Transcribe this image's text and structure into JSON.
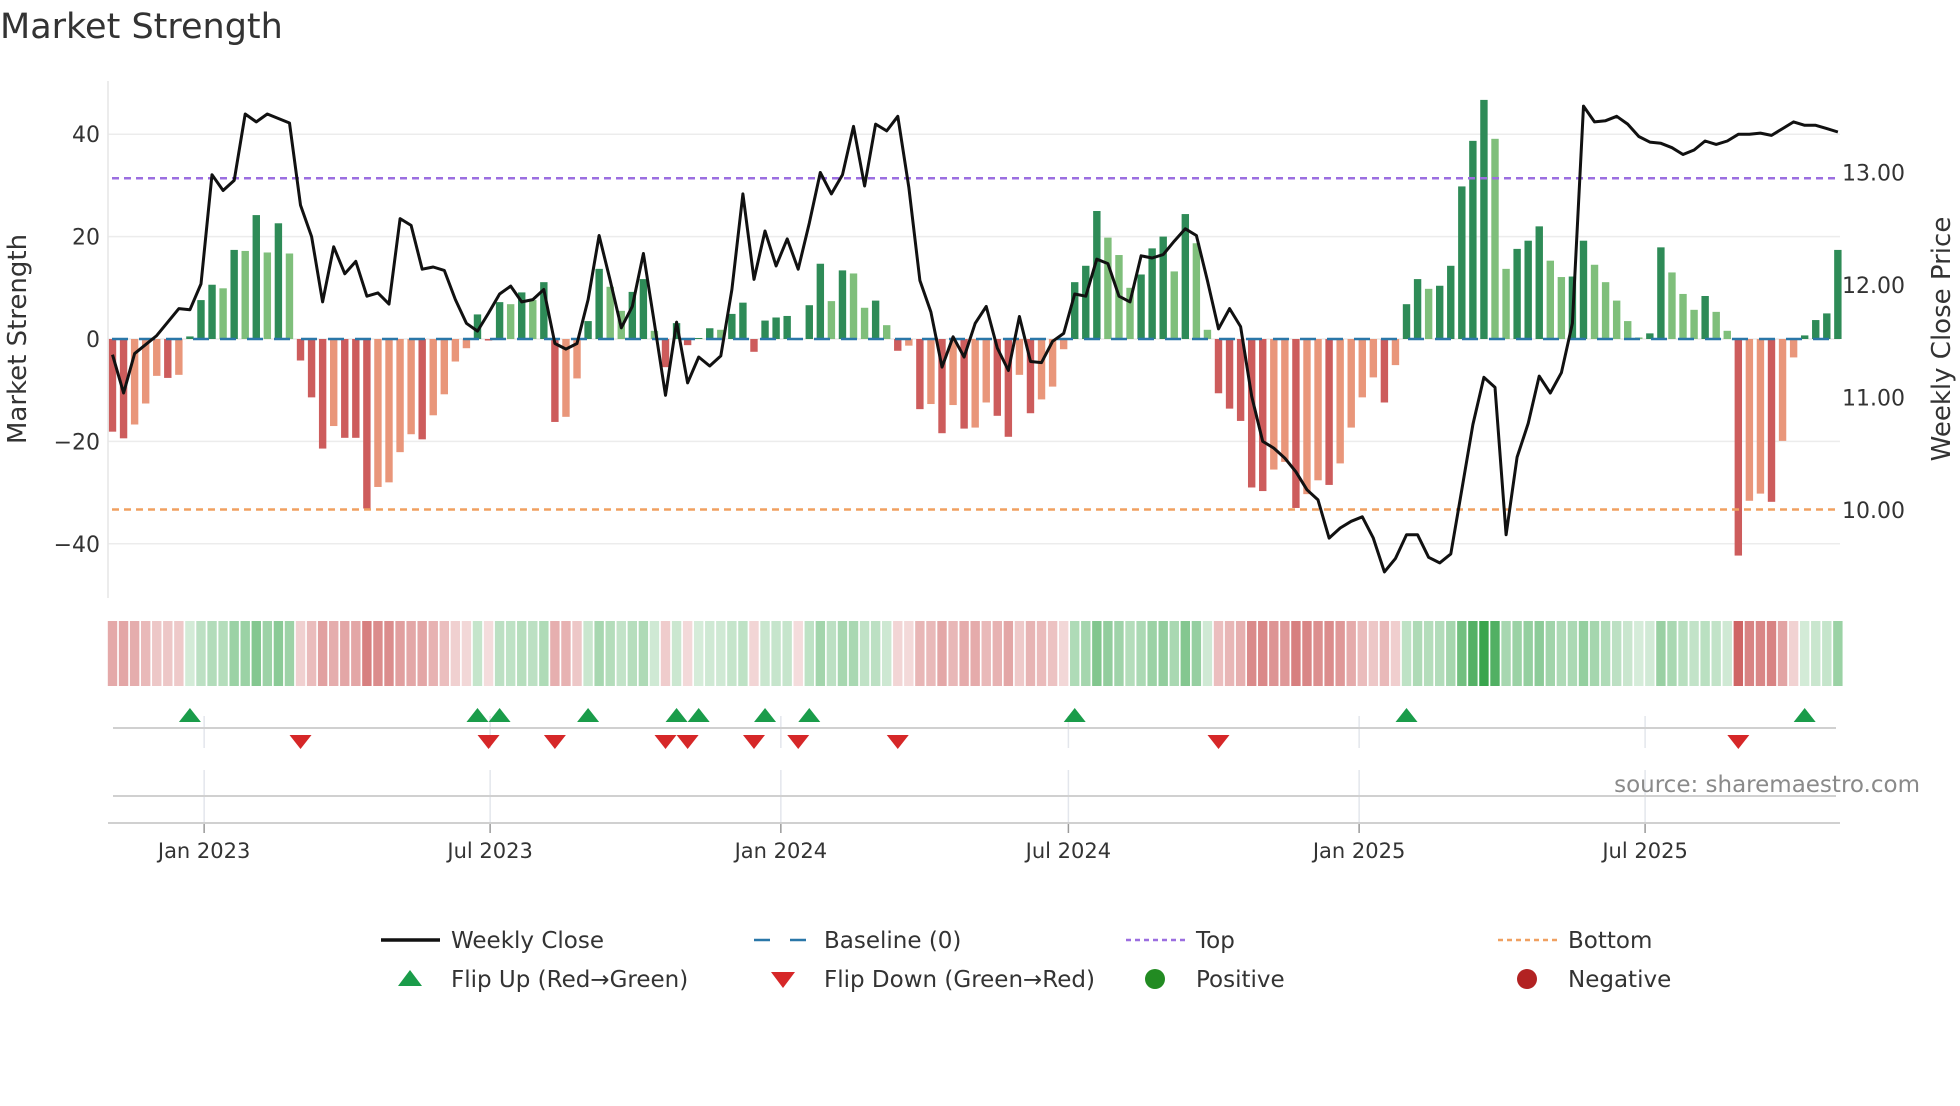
{
  "chart_data": {
    "type": "bar",
    "title": "Market Strength",
    "ylabel": "Market Strength",
    "y2label": "Weekly Close Price",
    "ylim": [
      -50,
      50
    ],
    "y2lim": [
      9.22,
      13.81
    ],
    "yticks": [
      40,
      20,
      0,
      -20,
      -40
    ],
    "y2ticks": [
      "13.00",
      "12.00",
      "11.00",
      "10.00"
    ],
    "xticks": [
      {
        "date": "2023-01-01",
        "label": "Jan 2023"
      },
      {
        "date": "2023-07-01",
        "label": "Jul 2023"
      },
      {
        "date": "2024-01-01",
        "label": "Jan 2024"
      },
      {
        "date": "2024-07-01",
        "label": "Jul 2024"
      },
      {
        "date": "2025-01-01",
        "label": "Jan 2025"
      },
      {
        "date": "2025-07-01",
        "label": "Jul 2025"
      }
    ],
    "start_date": "2022-11-04",
    "interval_days": 7,
    "top_level": 31.4,
    "bottom_level": -33.3,
    "baseline": 0,
    "strength": [
      -18.1,
      -19.4,
      -16.7,
      -12.6,
      -7.2,
      -7.6,
      -7.0,
      0.5,
      7.6,
      10.6,
      9.9,
      17.4,
      17.2,
      24.2,
      16.9,
      22.6,
      16.7,
      -4.2,
      -11.4,
      -21.4,
      -17.0,
      -19.3,
      -19.3,
      -33.1,
      -28.9,
      -28.0,
      -22.1,
      -18.6,
      -19.6,
      -14.9,
      -10.8,
      -4.4,
      -1.8,
      4.8,
      -0.3,
      7.2,
      6.8,
      9.1,
      7.6,
      11.1,
      -16.2,
      -15.2,
      -7.7,
      3.5,
      13.7,
      10.2,
      5.5,
      9.2,
      11.7,
      1.6,
      -5.5,
      3.1,
      -1.2,
      0.2,
      2.1,
      1.8,
      4.9,
      7.1,
      -2.5,
      3.6,
      4.2,
      4.5,
      -0.2,
      6.6,
      14.7,
      7.4,
      13.4,
      12.8,
      6.1,
      7.5,
      2.7,
      -2.3,
      -1.3,
      -13.7,
      -12.7,
      -18.4,
      -12.9,
      -17.5,
      -17.3,
      -12.4,
      -15.0,
      -19.1,
      -7.0,
      -14.5,
      -11.8,
      -9.3,
      -2.0,
      11.1,
      14.3,
      25.0,
      19.8,
      16.4,
      10.0,
      12.6,
      17.7,
      20.0,
      13.2,
      24.4,
      18.7,
      1.8,
      -10.6,
      -13.6,
      -16.0,
      -29.0,
      -29.7,
      -25.5,
      -24.0,
      -33.0,
      -30.3,
      -27.6,
      -28.5,
      -24.3,
      -17.3,
      -11.4,
      -7.5,
      -12.4,
      -5.1,
      6.8,
      11.7,
      9.8,
      10.4,
      14.3,
      29.8,
      38.7,
      46.7,
      39.1,
      13.7,
      17.6,
      19.2,
      22.0,
      15.3,
      12.1,
      12.2,
      19.2,
      14.5,
      11.1,
      7.5,
      3.5,
      0.3,
      1.1,
      17.9,
      13.0,
      8.8,
      5.7,
      8.4,
      5.3,
      1.6,
      -42.3,
      -31.6,
      -30.2,
      -31.8,
      -19.9,
      -3.6,
      0.7,
      3.7,
      5.0,
      17.4
    ],
    "weekly_close": [
      11.38,
      11.04,
      11.39,
      11.47,
      11.55,
      11.67,
      11.79,
      11.78,
      12.01,
      12.98,
      12.84,
      12.93,
      13.52,
      13.45,
      13.52,
      13.48,
      13.44,
      12.71,
      12.43,
      11.85,
      12.34,
      12.1,
      12.21,
      11.9,
      11.93,
      11.83,
      12.59,
      12.53,
      12.14,
      12.16,
      12.13,
      11.87,
      11.66,
      11.59,
      11.75,
      11.92,
      11.99,
      11.85,
      11.87,
      11.96,
      11.48,
      11.43,
      11.48,
      11.87,
      12.44,
      12.04,
      11.62,
      11.81,
      12.28,
      11.66,
      11.02,
      11.67,
      11.13,
      11.36,
      11.28,
      11.37,
      11.96,
      12.81,
      12.05,
      12.48,
      12.17,
      12.41,
      12.14,
      12.55,
      13.0,
      12.81,
      12.98,
      13.41,
      12.88,
      13.43,
      13.37,
      13.5,
      12.87,
      12.04,
      11.76,
      11.27,
      11.54,
      11.36,
      11.66,
      11.81,
      11.44,
      11.24,
      11.72,
      11.32,
      11.31,
      11.5,
      11.57,
      11.92,
      11.9,
      12.23,
      12.19,
      11.9,
      11.85,
      12.26,
      12.24,
      12.27,
      12.39,
      12.5,
      12.44,
      12.04,
      11.61,
      11.79,
      11.63,
      11.01,
      10.61,
      10.55,
      10.46,
      10.34,
      10.18,
      10.09,
      9.75,
      9.84,
      9.9,
      9.94,
      9.75,
      9.45,
      9.57,
      9.78,
      9.78,
      9.58,
      9.53,
      9.61,
      10.18,
      10.76,
      11.18,
      11.09,
      9.78,
      10.47,
      10.77,
      11.19,
      11.04,
      11.22,
      11.66,
      13.59,
      13.45,
      13.46,
      13.5,
      13.43,
      13.32,
      13.27,
      13.26,
      13.22,
      13.16,
      13.2,
      13.28,
      13.25,
      13.28,
      13.34,
      13.34,
      13.35,
      13.33,
      13.39,
      13.45,
      13.42,
      13.42,
      13.39,
      13.36
    ],
    "legend": {
      "placement": "bottom",
      "items": [
        {
          "key": "close",
          "label": "Weekly Close"
        },
        {
          "key": "baseline",
          "label": "Baseline (0)"
        },
        {
          "key": "top",
          "label": "Top"
        },
        {
          "key": "bottom",
          "label": "Bottom"
        },
        {
          "key": "flip_up",
          "label": "Flip Up (Red→Green)"
        },
        {
          "key": "flip_down",
          "label": "Flip Down (Green→Red)"
        },
        {
          "key": "positive",
          "label": "Positive"
        },
        {
          "key": "negative",
          "label": "Negative"
        }
      ]
    },
    "annotation": "source: sharemaestro.com"
  },
  "colors": {
    "pos_dark": "#2e8b57",
    "pos_light": "#7fbf7b",
    "neg_dark": "#cd5c5c",
    "neg_light": "#e9967a",
    "baseline": "#2a77a8",
    "top": "#9b6ee0",
    "bottom": "#f0a060",
    "flip_up": "#1a9c4a",
    "flip_down": "#d62728",
    "positive": "#228b22",
    "negative": "#b22222",
    "line": "#111111"
  }
}
